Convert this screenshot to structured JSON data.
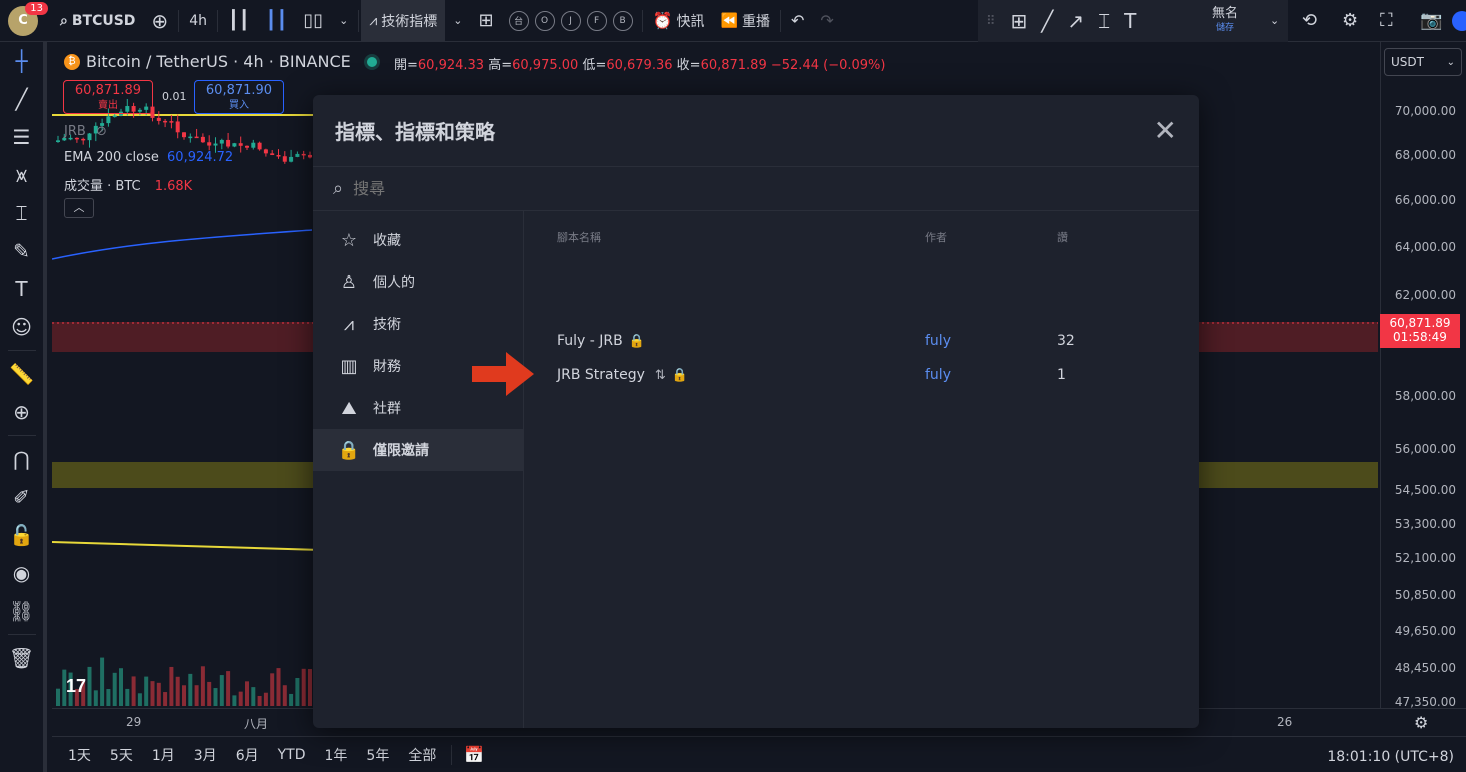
{
  "topbar": {
    "avatar_initial": "C",
    "notifications": "13",
    "symbol": "BTCUSD",
    "interval": "4h",
    "indicators_label": "技術指標",
    "template_letters": [
      "台",
      "O",
      "J",
      "F",
      "B"
    ],
    "alert_label": "快訊",
    "replay_label": "重播",
    "layout_name": "無名",
    "layout_save": "儲存"
  },
  "chart": {
    "symbol_title": "Bitcoin / TetherUS · 4h · BINANCE",
    "ohlc": {
      "open_label": "開=",
      "open": "60,924.33",
      "high_label": "高=",
      "high": "60,975.00",
      "low_label": "低=",
      "low": "60,679.36",
      "close_label": "收=",
      "close": "60,871.89",
      "change": "−52.44 (−0.09%)"
    },
    "sell": {
      "price": "60,871.89",
      "label": "賣出"
    },
    "buy": {
      "price": "60,871.90",
      "label": "買入"
    },
    "spread": "0.01",
    "legend": {
      "jrb": "JRB",
      "ema_label": "EMA 200 close",
      "ema_value": "60,924.72",
      "volume_label": "成交量 · BTC",
      "volume_value": "1.68K"
    },
    "currency": "USDT",
    "current_price": "60,871.89",
    "countdown": "01:58:49",
    "price_ticks": [
      "70,000.00",
      "68,000.00",
      "66,000.00",
      "64,000.00",
      "62,000.00",
      "58,000.00",
      "56,000.00",
      "54,500.00",
      "53,300.00",
      "52,100.00",
      "50,850.00",
      "49,650.00",
      "48,450.00",
      "47,350.00"
    ],
    "time_ticks": [
      "29",
      "八月",
      "26"
    ]
  },
  "bottombar": {
    "ranges": [
      "1天",
      "5天",
      "1月",
      "3月",
      "6月",
      "YTD",
      "1年",
      "5年",
      "全部"
    ],
    "clock": "18:01:10 (UTC+8)"
  },
  "dialog": {
    "title": "指標、指標和策略",
    "search_placeholder": "搜尋",
    "nav": [
      {
        "label": "收藏",
        "icon": "star-icon"
      },
      {
        "label": "個人的",
        "icon": "user-icon"
      },
      {
        "label": "技術",
        "icon": "chart-icon"
      },
      {
        "label": "財務",
        "icon": "bars-icon"
      },
      {
        "label": "社群",
        "icon": "community-icon"
      },
      {
        "label": "僅限邀請",
        "icon": "lock-icon"
      }
    ],
    "columns": {
      "name": "腳本名稱",
      "author": "作者",
      "likes": "讚"
    },
    "rows": [
      {
        "name": "Fuly - JRB",
        "author": "fuly",
        "likes": "32"
      },
      {
        "name": "JRB Strategy",
        "author": "fuly",
        "likes": "1"
      }
    ]
  }
}
